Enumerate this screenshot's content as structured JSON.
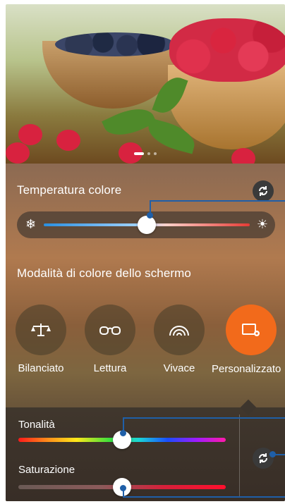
{
  "temperature": {
    "title": "Temperatura colore",
    "min_icon": "snowflake-icon",
    "max_icon": "sun-icon",
    "value": 0.5
  },
  "modes": {
    "title": "Modalità di colore dello schermo",
    "items": [
      {
        "label": "Bilanciato",
        "icon": "balance-scale-icon",
        "active": false
      },
      {
        "label": "Lettura",
        "icon": "reading-glasses-icon",
        "active": false
      },
      {
        "label": "Vivace",
        "icon": "rainbow-icon",
        "active": false
      },
      {
        "label": "Personalizzato",
        "icon": "custom-display-icon",
        "active": true
      }
    ]
  },
  "custom": {
    "hue_label": "Tonalità",
    "hue_value": 0.5,
    "saturation_label": "Saturazione",
    "saturation_value": 0.5
  },
  "colors": {
    "accent_active": "#f26a1b",
    "callout": "#1f5fa8"
  }
}
